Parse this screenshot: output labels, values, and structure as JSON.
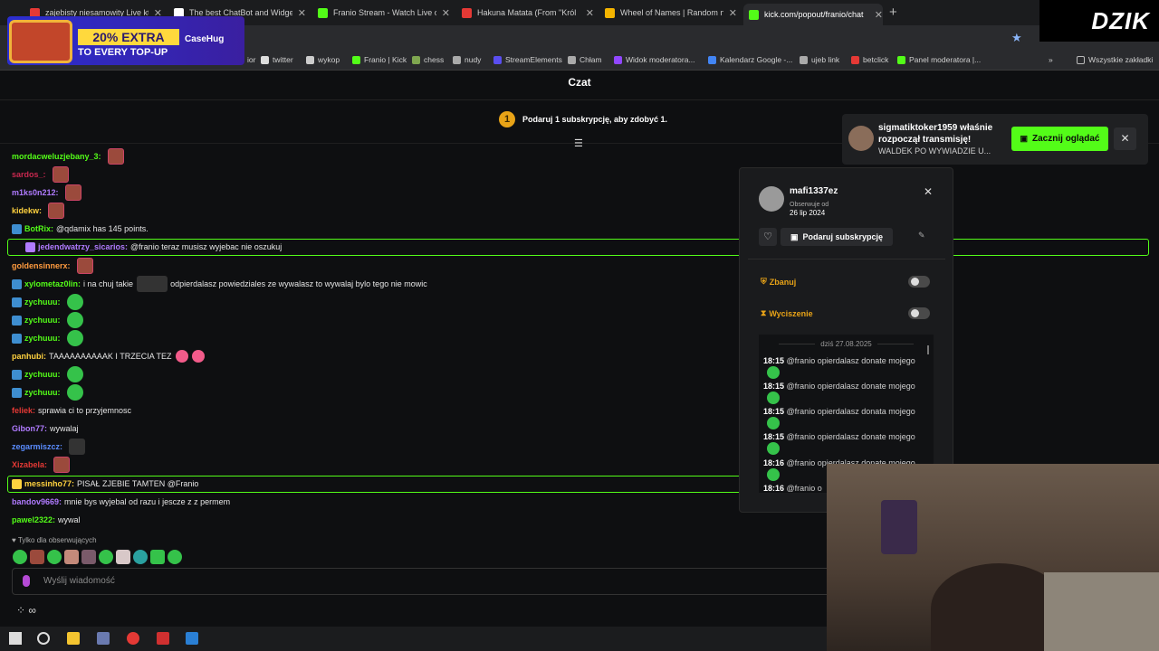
{
  "tabs": [
    {
      "label": "zajebisty niesamowity Live któr",
      "color": "#e53935"
    },
    {
      "label": "The best ChatBot and Widgets",
      "color": "#ffffff"
    },
    {
      "label": "Franio Stream - Watch Live on",
      "color": "#53fc18"
    },
    {
      "label": "Hakuna Matata (From \"Król",
      "color": "#e53935"
    },
    {
      "label": "Wheel of Names | Random nam",
      "color": "#f4b400"
    },
    {
      "label": "kick.com/popout/franio/chat",
      "color": "#53fc18"
    }
  ],
  "bookmarks": [
    {
      "label": "ior",
      "color": "#888888"
    },
    {
      "label": "twitter",
      "color": "#dddddd"
    },
    {
      "label": "wykop",
      "color": "#cccccc"
    },
    {
      "label": "Franio | Kick",
      "color": "#53fc18"
    },
    {
      "label": "chess",
      "color": "#7fa650"
    },
    {
      "label": "nudy",
      "color": "#aaaaaa"
    },
    {
      "label": "StreamElements",
      "color": "#5a4ef0"
    },
    {
      "label": "Chłam",
      "color": "#aaaaaa"
    },
    {
      "label": "Widok moderatora...",
      "color": "#9147ff"
    },
    {
      "label": "Kalendarz Google -...",
      "color": "#4285f4"
    },
    {
      "label": "ujeb link",
      "color": "#aaaaaa"
    },
    {
      "label": "betclick",
      "color": "#e53935"
    },
    {
      "label": "Panel moderatora |...",
      "color": "#53fc18"
    }
  ],
  "bookmarks_more": "»",
  "all_bookmarks": "Wszystkie zakładki",
  "promo": {
    "badge": "20% EXTRA",
    "text": "TO EVERY TOP-UP",
    "brand": "CaseHug"
  },
  "corner_logo": "DZIK",
  "chat": {
    "title": "Czat",
    "sub_promo": "Podaruj 1 subskrypcję, aby zdobyć 1.",
    "sub_promo_count": "1",
    "messages": [
      {
        "user": "mordacweluzjebany_3:",
        "color": "#53fc18",
        "text": "",
        "emote": "red",
        "badge": ""
      },
      {
        "user": "sardos_:",
        "color": "#c9284f",
        "text": "",
        "emote": "red",
        "badge": ""
      },
      {
        "user": "m1ks0n212:",
        "color": "#b07bff",
        "text": "",
        "emote": "red",
        "badge": ""
      },
      {
        "user": "kidekw:",
        "color": "#ffd23f",
        "text": "",
        "emote": "red",
        "badge": ""
      },
      {
        "user": "BotRix:",
        "color": "#53fc18",
        "text": "@qdamix has 145 points.",
        "emote": "",
        "badge": "bot"
      },
      {
        "user": "jedendwatrzy_sicarios:",
        "color": "#b07bff",
        "text": "@franio teraz musisz wyjebac nie oszukuj",
        "emote": "",
        "badge": "sub"
      },
      {
        "user": "goldensinnerx:",
        "color": "#ff9b3f",
        "text": "",
        "emote": "red",
        "badge": ""
      },
      {
        "user": "xylometaz0lin:",
        "color": "#53fc18",
        "text": "i na chuj takie",
        "text2": "odpierdalasz powiedziales ze wywalasz to wywalaj bylo tego nie mowic",
        "emote": "",
        "badge": "mod"
      },
      {
        "user": "zychuuu:",
        "color": "#53fc18",
        "text": "",
        "emote": "green",
        "badge": "mod"
      },
      {
        "user": "zychuuu:",
        "color": "#53fc18",
        "text": "",
        "emote": "green",
        "badge": "mod"
      },
      {
        "user": "zychuuu:",
        "color": "#53fc18",
        "text": "",
        "emote": "green",
        "badge": "mod"
      },
      {
        "user": "panhubi:",
        "color": "#ffd23f",
        "text": "TAAAAAAAAAAK I TRZECIA TEZ",
        "emote": "pink",
        "badge": ""
      },
      {
        "user": "zychuuu:",
        "color": "#53fc18",
        "text": "",
        "emote": "green",
        "badge": "mod"
      },
      {
        "user": "zychuuu:",
        "color": "#53fc18",
        "text": "",
        "emote": "green",
        "badge": "mod"
      },
      {
        "user": "feliek:",
        "color": "#e53935",
        "text": "sprawia ci to przyjemnosc",
        "emote": "",
        "badge": ""
      },
      {
        "user": "Gibon77:",
        "color": "#b07bff",
        "text": "wywalaj",
        "emote": "",
        "badge": ""
      },
      {
        "user": "zegarmiszcz:",
        "color": "#5a8cff",
        "text": "",
        "emote": "dark",
        "badge": ""
      },
      {
        "user": "Xizabela:",
        "color": "#e53935",
        "text": "",
        "emote": "red",
        "badge": ""
      },
      {
        "user": "messinho77:",
        "color": "#ffd23f",
        "text": "PISAŁ ZJEBIE TAMTEN @Franio",
        "emote": "",
        "badge": "gift"
      },
      {
        "user": "bandov9669:",
        "color": "#b07bff",
        "text": "mnie bys wyjebal od razu i jescze z z permem",
        "emote": "",
        "badge": ""
      },
      {
        "user": "pawel2322:",
        "color": "#53fc18",
        "text": "wywal",
        "emote": "",
        "badge": ""
      }
    ],
    "followers_only": "Tylko dla obserwujących",
    "input_placeholder": "Wyślij wiadomość",
    "bottom_icons": "⁘ ∞"
  },
  "user_card": {
    "username": "mafi1337ez",
    "follows_label": "Obserwuje od",
    "follows_date": "26 lip 2024",
    "gift_label": "Podaruj subskrypcję",
    "ban_label": "Zbanuj",
    "timeout_label": "Wyciszenie",
    "history_date": "dziś 27.08.2025",
    "history": [
      {
        "time": "18:15",
        "text": "@franio opierdalasz donate mojego"
      },
      {
        "time": "18:15",
        "text": "@franio opierdalasz donate mojego"
      },
      {
        "time": "18:15",
        "text": "@franio opierdalasz donata mojego"
      },
      {
        "time": "18:15",
        "text": "@franio opierdalasz donate mojego"
      },
      {
        "time": "18:16",
        "text": "@franio opierdalasz donate mojego"
      },
      {
        "time": "18:16",
        "text": "@franio o"
      }
    ]
  },
  "notification": {
    "title": "sigmatiktoker1959 właśnie rozpoczął transmisję!",
    "subtitle": "WALDEK PO WYWIADZIE U...",
    "watch_label": "Zacznij oglądać"
  },
  "colors": {
    "accent": "#53fc18",
    "moderation": "#e8a317",
    "background": "#0e0f11"
  }
}
